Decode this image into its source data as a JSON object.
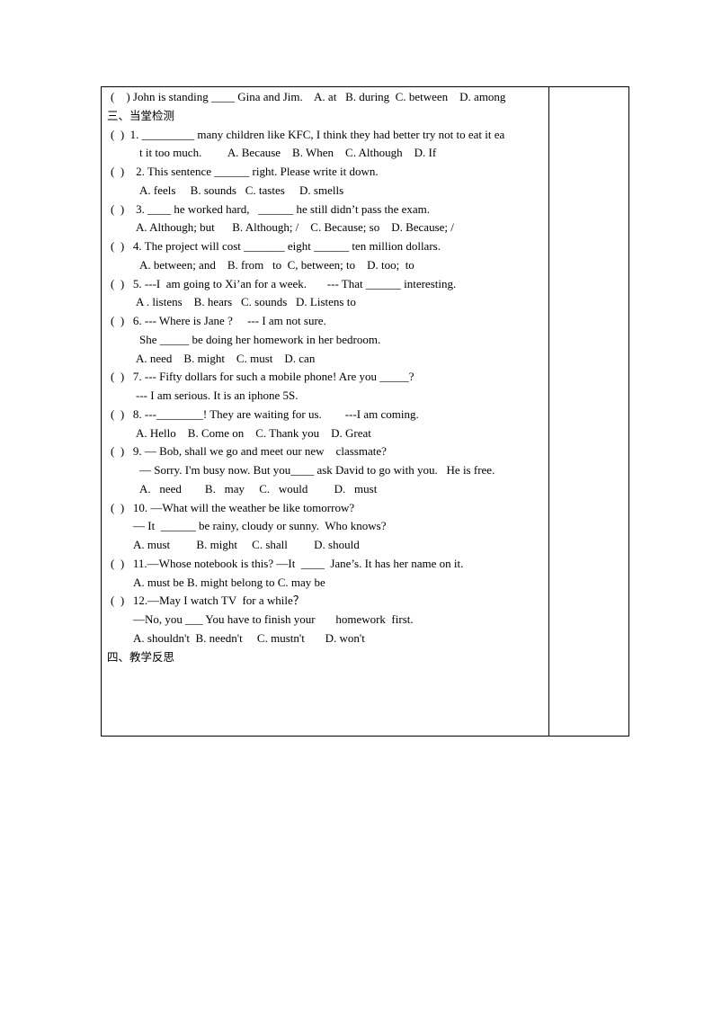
{
  "lines": [
    {
      "text": "(    ) John is standing ____ Gina and Jim.    A. at   B. during  C. between    D. among",
      "indent": 10,
      "type": "q"
    },
    {
      "text": "三、当堂检测",
      "indent": 6,
      "type": "h"
    },
    {
      "text": "(  )  1. _________ many children like KFC, I think they had better try not to eat it ea",
      "indent": 10,
      "type": "q"
    },
    {
      "text": "t it too much.         A. Because    B. When    C. Although    D. If",
      "indent": 42,
      "type": "q"
    },
    {
      "text": "(  )    2. This sentence ______ right. Please write it down.",
      "indent": 10,
      "type": "q"
    },
    {
      "text": "A. feels     B. sounds   C. tastes     D. smells",
      "indent": 42,
      "type": "q"
    },
    {
      "text": "(  )    3. ____ he worked hard,   ______ he still didn’t pass the exam.",
      "indent": 10,
      "type": "q"
    },
    {
      "text": "A. Although; but      B. Although; /    C. Because; so    D. Because; /",
      "indent": 38,
      "type": "q"
    },
    {
      "text": "(  )   4. The project will cost _______ eight ______ ten million dollars.",
      "indent": 10,
      "type": "q"
    },
    {
      "text": "A. between; and    B. from   to  C, between; to    D. too;  to",
      "indent": 42,
      "type": "q"
    },
    {
      "text": "(  )   5. ---I  am going to Xi’an for a week.       --- That ______ interesting.",
      "indent": 10,
      "type": "q"
    },
    {
      "text": "A . listens    B. hears   C. sounds   D. Listens to",
      "indent": 38,
      "type": "q"
    },
    {
      "text": "(  )   6. --- Where is Jane ?     --- I am not sure.",
      "indent": 10,
      "type": "q"
    },
    {
      "text": "She _____ be doing her homework in her bedroom.",
      "indent": 42,
      "type": "q"
    },
    {
      "text": "A. need    B. might    C. must    D. can",
      "indent": 38,
      "type": "q"
    },
    {
      "text": "(  )   7. --- Fifty dollars for such a mobile phone! Are you _____?",
      "indent": 10,
      "type": "q"
    },
    {
      "text": "--- I am serious. It is an iphone 5S.",
      "indent": 38,
      "type": "q"
    },
    {
      "text": "(  )   8. ---________! They are waiting for us.        ---I am coming.",
      "indent": 10,
      "type": "q"
    },
    {
      "text": "A. Hello    B. Come on    C. Thank you    D. Great",
      "indent": 38,
      "type": "q"
    },
    {
      "text": "(  )   9. — Bob, shall we go and meet our new    classmate?",
      "indent": 10,
      "type": "q"
    },
    {
      "text": "— Sorry. I'm busy now. But you____ ask David to go with you.   He is free.",
      "indent": 42,
      "type": "q"
    },
    {
      "text": "A.   need        B.   may     C.   would         D.   must",
      "indent": 42,
      "type": "q"
    },
    {
      "text": "(  )   10. —What will the weather be like tomorrow?",
      "indent": 10,
      "type": "q"
    },
    {
      "text": "— It  ______ be rainy, cloudy or sunny.  Who knows?",
      "indent": 35,
      "type": "q"
    },
    {
      "text": "A. must         B. might     C. shall         D. should",
      "indent": 35,
      "type": "q"
    },
    {
      "text": "(  )   11.—Whose notebook is this? —It  ____  Jane’s. It has her name on it.",
      "indent": 10,
      "type": "q"
    },
    {
      "text": "A. must be B. might belong to C. may be",
      "indent": 35,
      "type": "q"
    },
    {
      "text": "(  )   12.—May I watch TV  for a while？",
      "indent": 10,
      "type": "q"
    },
    {
      "text": "—No, you ___ You have to finish your       homework  first.",
      "indent": 35,
      "type": "q"
    },
    {
      "text": "A. shouldn't  B. needn't     C. mustn't       D. won't",
      "indent": 35,
      "type": "q"
    },
    {
      "text": "四、教学反思",
      "indent": 6,
      "type": "h"
    }
  ]
}
